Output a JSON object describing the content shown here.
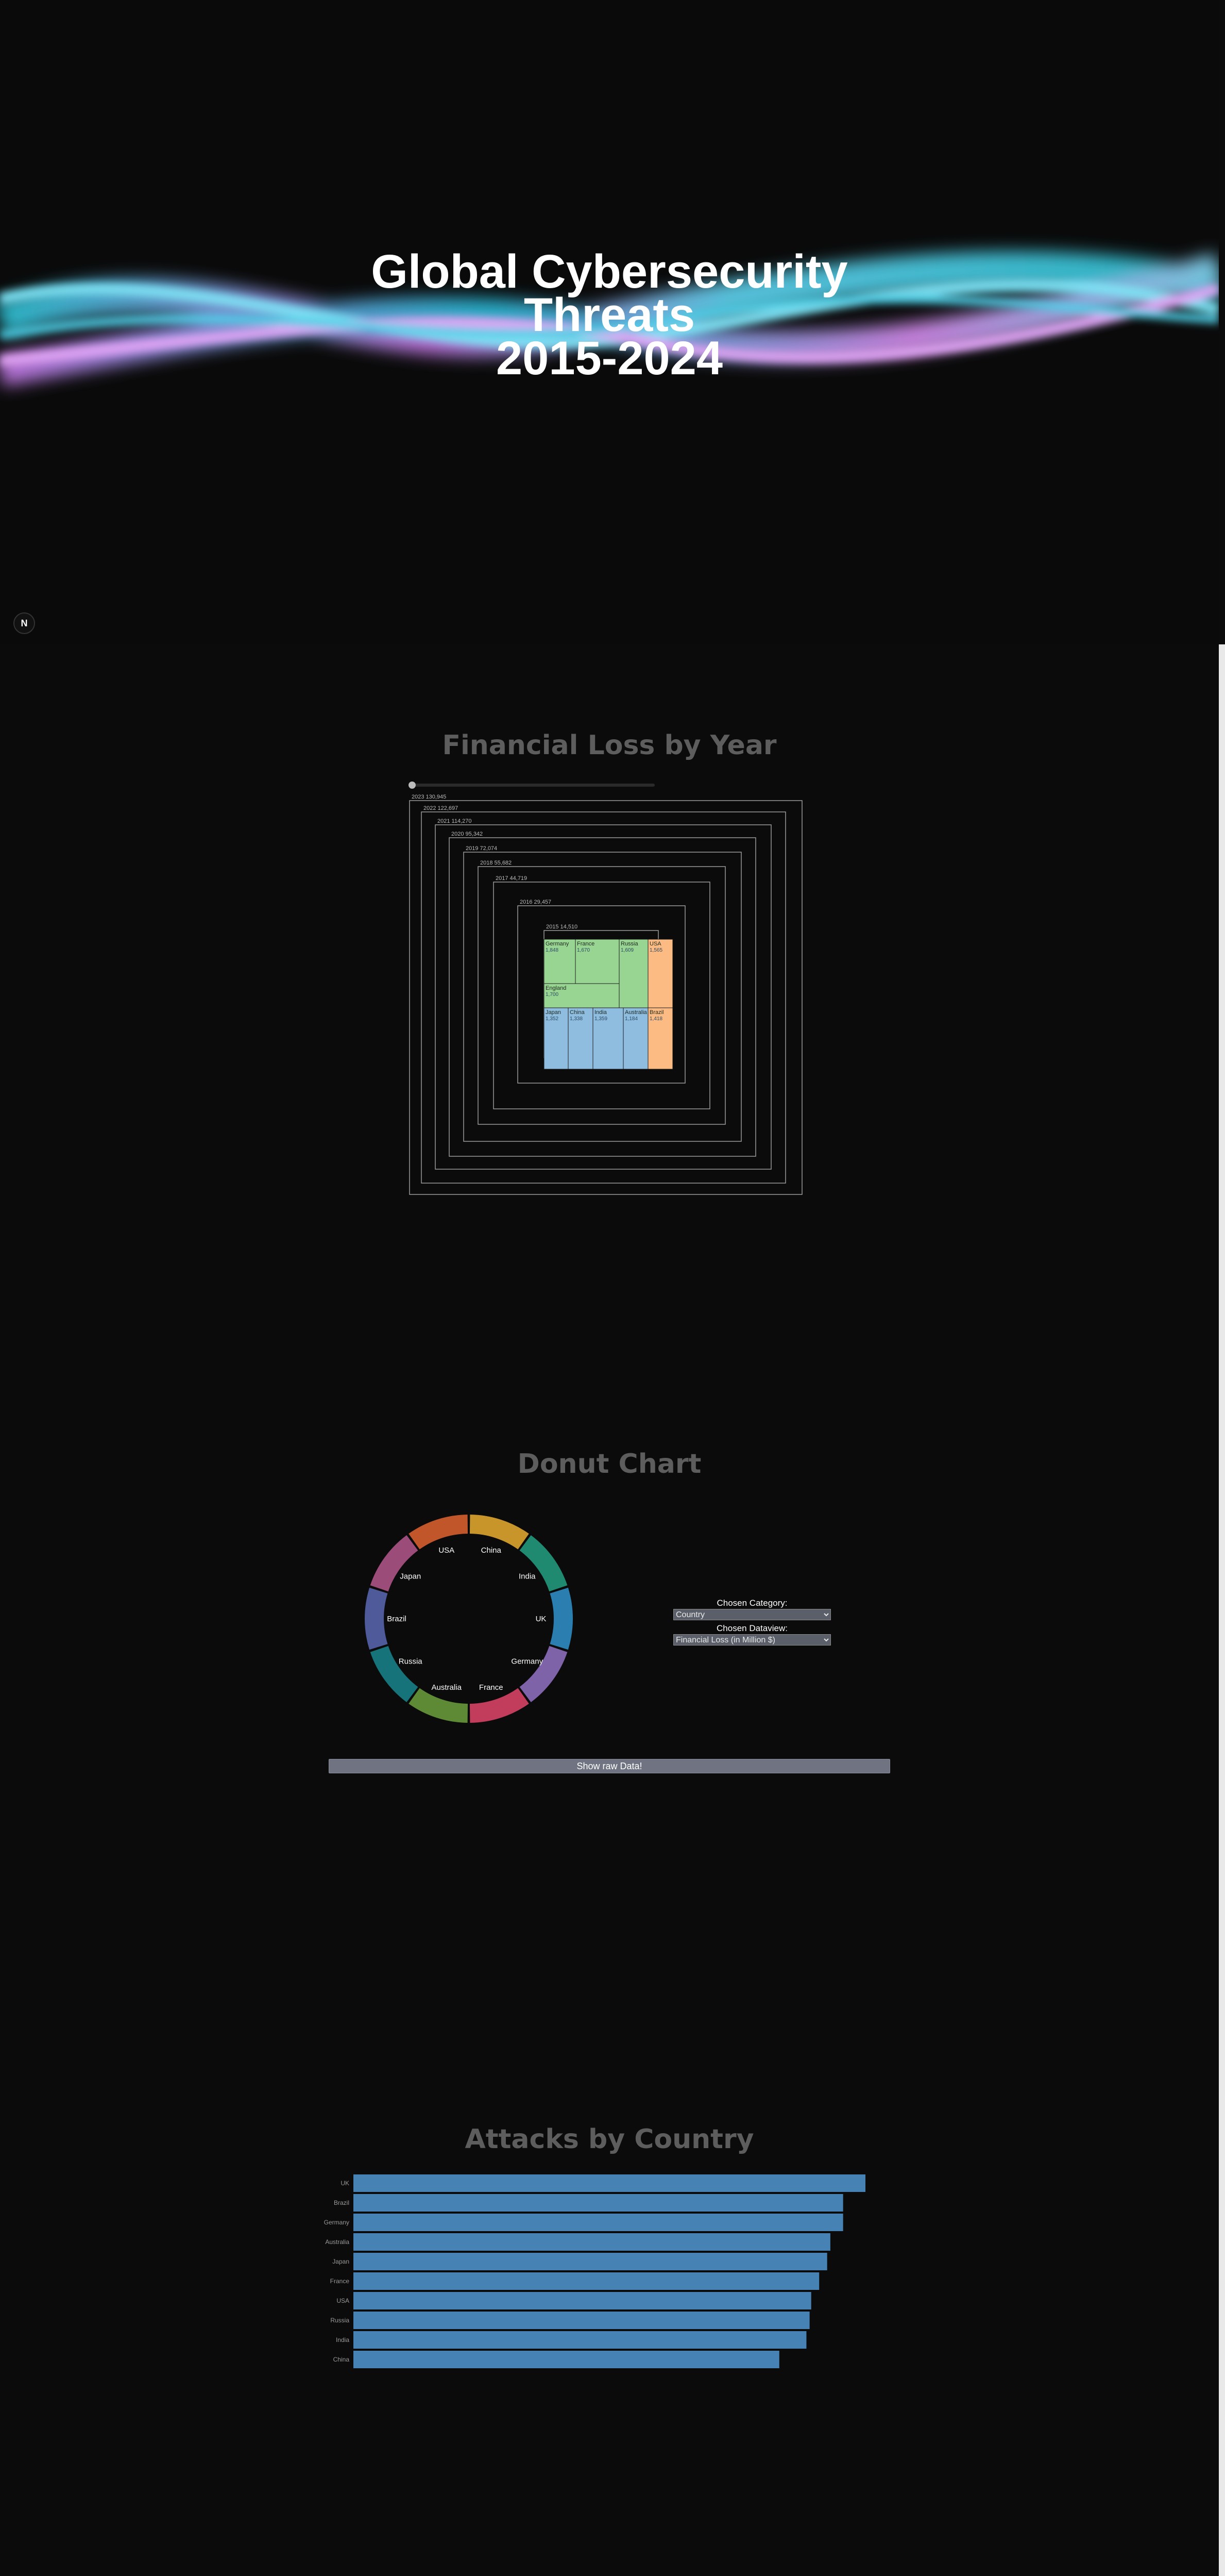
{
  "hero": {
    "title_lines": [
      "Global Cybersecurity",
      "Threats",
      "2015-2024"
    ],
    "badge": "N"
  },
  "treemap": {
    "title": "Financial Loss by Year",
    "years": [
      {
        "label": "2023 130,945"
      },
      {
        "label": "2022 122,697"
      },
      {
        "label": "2021 114,270"
      },
      {
        "label": "2020 95,342"
      },
      {
        "label": "2019 72,074"
      },
      {
        "label": "2018 55,682"
      },
      {
        "label": "2017 44,719"
      },
      {
        "label": "2016 29,457"
      },
      {
        "label": "2015 14,510"
      }
    ],
    "cells": [
      {
        "name": "Germany",
        "value": "1,848",
        "group": "europe"
      },
      {
        "name": "France",
        "value": "1,670",
        "group": "europe"
      },
      {
        "name": "Russia",
        "value": "1,609",
        "group": "europe"
      },
      {
        "name": "USA",
        "value": "1,565",
        "group": "america"
      },
      {
        "name": "England",
        "value": "1,700",
        "group": "europe"
      },
      {
        "name": "Brazil",
        "value": "1,418",
        "group": "america"
      },
      {
        "name": "Japan",
        "value": "1,352",
        "group": "asia"
      },
      {
        "name": "China",
        "value": "1,338",
        "group": "asia"
      },
      {
        "name": "India",
        "value": "1,359",
        "group": "asia"
      },
      {
        "name": "Australia",
        "value": "1,184",
        "group": "asia"
      }
    ],
    "colors": {
      "europe": "#98d593",
      "america": "#fdbb84",
      "asia": "#8fbde0",
      "frame": "#9a9a9a"
    }
  },
  "donut": {
    "title": "Donut Chart",
    "segments": [
      {
        "name": "China",
        "color": "#c8952a"
      },
      {
        "name": "India",
        "color": "#1f8a70"
      },
      {
        "name": "UK",
        "color": "#2a7fb0"
      },
      {
        "name": "Germany",
        "color": "#7e63a8"
      },
      {
        "name": "France",
        "color": "#c23d5b"
      },
      {
        "name": "Australia",
        "color": "#5e8a35"
      },
      {
        "name": "Russia",
        "color": "#16737a"
      },
      {
        "name": "Brazil",
        "color": "#4e5a9a"
      },
      {
        "name": "Japan",
        "color": "#9c4c78"
      },
      {
        "name": "USA",
        "color": "#c0562a"
      }
    ],
    "category_label": "Chosen Category:",
    "category_value": "Country",
    "dataview_label": "Chosen Dataview:",
    "dataview_value": "Financial Loss (in Million $)",
    "raw_button": "Show raw Data!"
  },
  "chart_data": {
    "type": "bar",
    "title": "Attacks by Country",
    "orientation": "horizontal",
    "categories": [
      "UK",
      "Brazil",
      "Germany",
      "Australia",
      "Japan",
      "France",
      "USA",
      "Russia",
      "India",
      "China"
    ],
    "values": [
      321,
      307,
      307,
      299,
      297,
      292,
      287,
      286,
      284,
      267
    ],
    "xlim": [
      0,
      321
    ],
    "bar_color": "#4682b4"
  }
}
